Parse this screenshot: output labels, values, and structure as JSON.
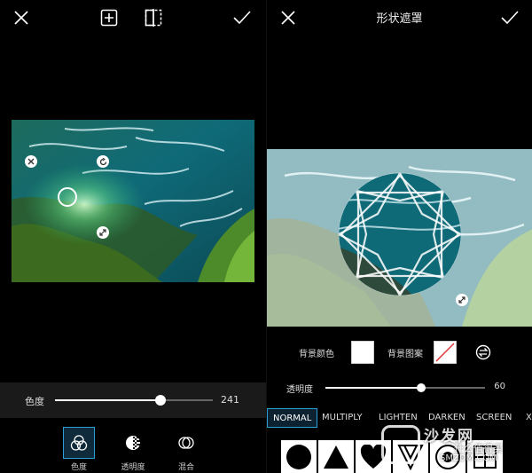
{
  "left": {
    "slider": {
      "label": "色度",
      "value": "241",
      "level": 0.67
    },
    "tools": [
      {
        "label": "色度",
        "icon": "hue-icon"
      },
      {
        "label": "透明度",
        "icon": "opacity-icon"
      },
      {
        "label": "混合",
        "icon": "blend-icon"
      }
    ]
  },
  "right": {
    "title": "形状遮罩",
    "background": {
      "color_label": "背景颜色",
      "pattern_label": "背景图案"
    },
    "opacity": {
      "label": "透明度",
      "value": "60",
      "level": 0.6
    },
    "blend_modes": [
      "NORMAL",
      "MULTIPLY",
      "LIGHTEN",
      "DARKEN",
      "SCREEN",
      "XO"
    ],
    "shapes": [
      "circle",
      "triangle",
      "heart",
      "pattern",
      "pattern2",
      "pattern3"
    ]
  },
  "watermark": {
    "brand": "沙发网",
    "sub": "什么值得买",
    "url": "SMZDM.COM"
  },
  "colors": {
    "accent": "#2a9fd6",
    "bg": "#000000",
    "bar": "#1a1a1a"
  }
}
